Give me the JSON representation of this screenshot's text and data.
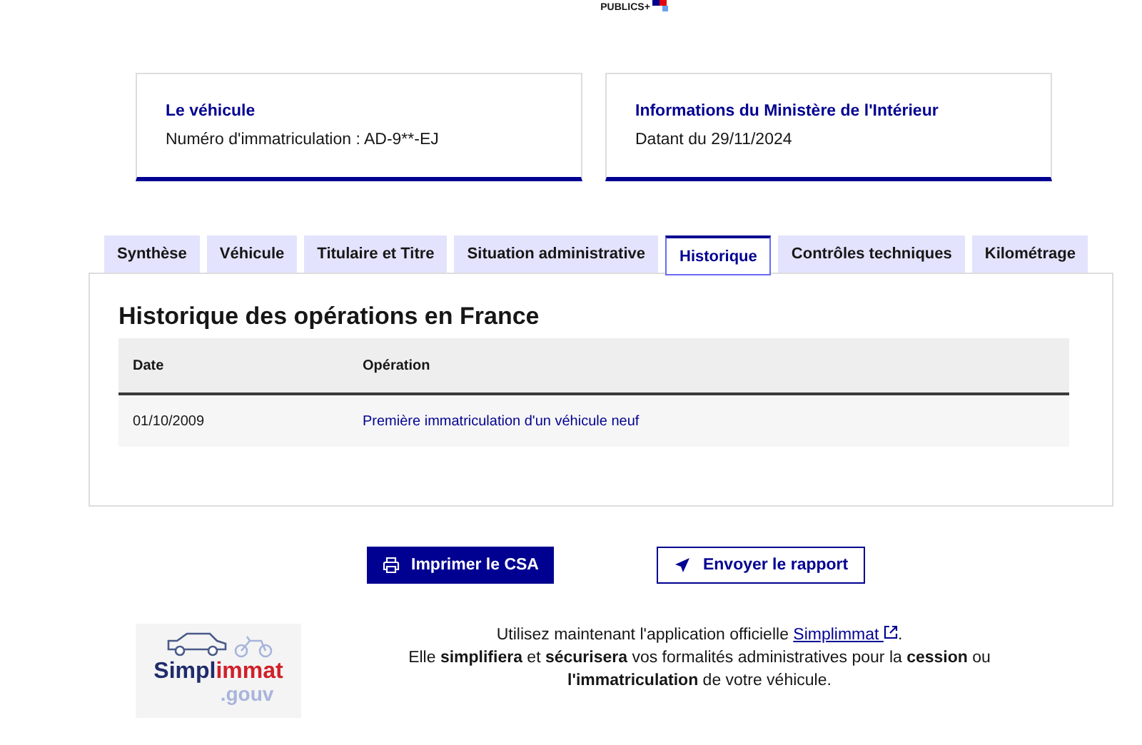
{
  "header": {
    "logo_text": "PUBLICS+"
  },
  "cards": [
    {
      "title": "Le véhicule",
      "text": "Numéro d'immatriculation : AD-9**-EJ"
    },
    {
      "title": "Informations du Ministère de l'Intérieur",
      "text": "Datant du 29/11/2024"
    }
  ],
  "tabs": [
    {
      "label": "Synthèse",
      "selected": false
    },
    {
      "label": "Véhicule",
      "selected": false
    },
    {
      "label": "Titulaire et Titre",
      "selected": false
    },
    {
      "label": "Situation administrative",
      "selected": false
    },
    {
      "label": "Historique",
      "selected": true
    },
    {
      "label": "Contrôles techniques",
      "selected": false
    },
    {
      "label": "Kilométrage",
      "selected": false
    }
  ],
  "panel": {
    "title": "Historique des opérations en France",
    "table": {
      "columns": [
        "Date",
        "Opération"
      ],
      "rows": [
        {
          "date": "01/10/2009",
          "operation": "Première immatriculation d'un véhicule neuf"
        }
      ]
    }
  },
  "buttons": [
    {
      "kind": "primary",
      "label": "Imprimer le CSA"
    },
    {
      "kind": "secondary",
      "label": "Envoyer le rapport"
    }
  ],
  "promo": {
    "logo": {
      "part_1": "Simpl",
      "part_2": "immat",
      "part_3": ".gouv"
    },
    "line_1_before": "Utilisez maintenant l'application officielle",
    "link": "Simplimmat",
    "line_1_after": ".",
    "line_2": "Elle **simplifiera** et **sécurisera** vos formalités administratives pour la **cession** ou **l'immatriculation** de votre véhicule."
  }
}
